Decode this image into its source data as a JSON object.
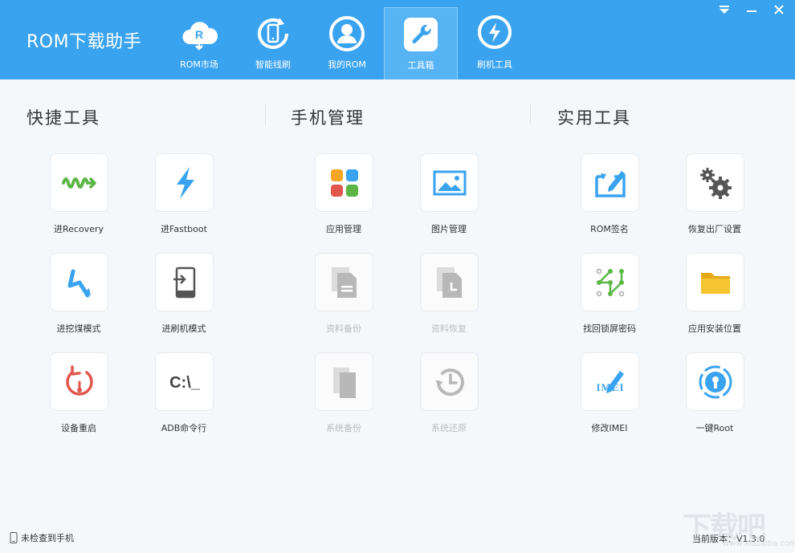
{
  "app": {
    "title": "ROM下载助手"
  },
  "nav": {
    "tabs": [
      {
        "label": "ROM市场",
        "icon": "cloud-r-icon"
      },
      {
        "label": "智能线刷",
        "icon": "phone-refresh-icon"
      },
      {
        "label": "我的ROM",
        "icon": "user-icon"
      },
      {
        "label": "工具箱",
        "icon": "wrench-icon",
        "active": true
      },
      {
        "label": "刷机工具",
        "icon": "lightning-icon"
      }
    ]
  },
  "window_controls": {
    "menu": "dropdown-icon",
    "minimize": "minimize-icon",
    "close": "close-icon"
  },
  "sections": {
    "quick": {
      "title": "快捷工具"
    },
    "phone": {
      "title": "手机管理"
    },
    "utility": {
      "title": "实用工具"
    }
  },
  "tools": {
    "recovery": {
      "label": "进Recovery",
      "icon": "recovery-wave-icon"
    },
    "fastboot": {
      "label": "进Fastboot",
      "icon": "fastboot-bolt-icon"
    },
    "dig_mode": {
      "label": "进挖煤模式",
      "icon": "dig-mode-icon"
    },
    "flash_mode": {
      "label": "进刷机模式",
      "icon": "flash-mode-icon"
    },
    "reboot": {
      "label": "设备重启",
      "icon": "reboot-icon"
    },
    "adb": {
      "label": "ADB命令行",
      "icon": "terminal-icon",
      "glyph": "C:\\_"
    },
    "app_manage": {
      "label": "应用管理",
      "icon": "apps-grid-icon"
    },
    "photo_manage": {
      "label": "图片管理",
      "icon": "picture-icon"
    },
    "data_backup": {
      "label": "资料备份",
      "icon": "document-icon",
      "disabled": true
    },
    "data_restore": {
      "label": "资料恢复",
      "icon": "document-clock-icon",
      "disabled": true
    },
    "system_backup": {
      "label": "系统备份",
      "icon": "copy-icon",
      "disabled": true
    },
    "system_restore": {
      "label": "系统还原",
      "icon": "restore-clock-icon",
      "disabled": true
    },
    "rom_sign": {
      "label": "ROM签名",
      "icon": "sign-box-icon"
    },
    "factory_reset": {
      "label": "恢复出厂设置",
      "icon": "gears-icon"
    },
    "find_pattern": {
      "label": "找回锁屏密码",
      "icon": "pattern-lock-icon"
    },
    "install_location": {
      "label": "应用安装位置",
      "icon": "folder-icon"
    },
    "modify_imei": {
      "label": "修改IMEI",
      "icon": "imei-pen-icon",
      "glyph": "IMEI"
    },
    "one_click_root": {
      "label": "一键Root",
      "icon": "root-lock-icon"
    }
  },
  "footer": {
    "status": "未检查到手机",
    "version": "当前版本：V1.3.0"
  },
  "watermark": {
    "text": "下载吧",
    "sub": "www.xiazaiba.com"
  },
  "colors": {
    "header": "#3aa3f0",
    "tab_active": "#56b3f4",
    "green": "#5cb646",
    "blue": "#3aa3f0",
    "red": "#e2574c",
    "orange": "#f5a623",
    "gray": "#b8b8b8"
  }
}
